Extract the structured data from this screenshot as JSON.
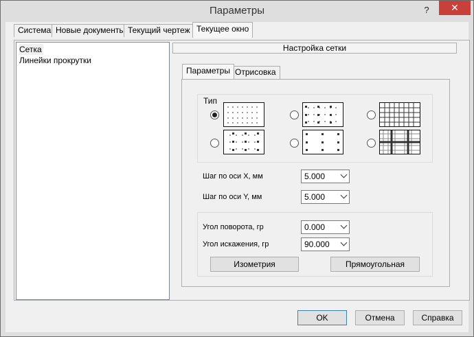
{
  "window": {
    "title": "Параметры",
    "help_label": "?",
    "close_label": "✕"
  },
  "tabs": [
    {
      "label": "Система"
    },
    {
      "label": "Новые документы"
    },
    {
      "label": "Текущий чертеж"
    },
    {
      "label": "Текущее окно",
      "active": true
    }
  ],
  "tree": {
    "items": [
      {
        "label": "Сетка",
        "selected": true
      },
      {
        "label": "Линейки прокрутки",
        "selected": false
      }
    ]
  },
  "section": {
    "header": "Настройка сетки"
  },
  "subtabs": [
    {
      "label": "Параметры",
      "active": true
    },
    {
      "label": "Отрисовка"
    }
  ],
  "type_group": {
    "title": "Тип",
    "selected_index": 0
  },
  "step": {
    "x_label": "Шаг по оси  X, мм",
    "x_value": "5.000",
    "y_label": "Шаг по оси  Y, мм",
    "y_value": "5.000"
  },
  "angles": {
    "rotation_label": "Угол поворота, гр",
    "rotation_value": "0.000",
    "skew_label": "Угол искажения, гр",
    "skew_value": "90.000",
    "isometry_button": "Изометрия",
    "rectangular_button": "Прямоугольная"
  },
  "footer": {
    "ok": "OK",
    "cancel": "Отмена",
    "help": "Справка"
  }
}
